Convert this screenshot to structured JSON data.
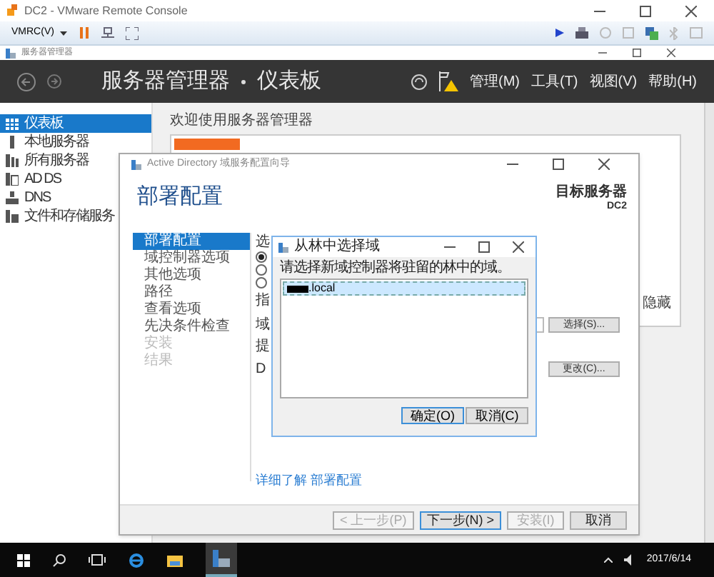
{
  "vmrc": {
    "title": "DC2 - VMware Remote Console",
    "menu": "VMRC(V)"
  },
  "server_manager": {
    "window_title": "服务器管理器",
    "breadcrumb": [
      "服务器管理器",
      "仪表板"
    ],
    "menus": [
      "管理(M)",
      "工具(T)",
      "视图(V)",
      "帮助(H)"
    ],
    "sidebar": [
      {
        "label": "仪表板",
        "selected": true,
        "kind": "dashboard"
      },
      {
        "label": "本地服务器",
        "selected": false,
        "kind": "server"
      },
      {
        "label": "所有服务器",
        "selected": false,
        "kind": "servers"
      },
      {
        "label": "AD DS",
        "selected": false,
        "kind": "adds"
      },
      {
        "label": "DNS",
        "selected": false,
        "kind": "dns"
      },
      {
        "label": "文件和存储服务",
        "selected": false,
        "kind": "files"
      }
    ],
    "welcome": "欢迎使用服务器管理器",
    "hide": "隐藏"
  },
  "wizard": {
    "title": "Active Directory 域服务配置向导",
    "heading": "部署配置",
    "target_label": "目标服务器",
    "target_value": "DC2",
    "steps": [
      {
        "label": "部署配置",
        "selected": true,
        "disabled": false
      },
      {
        "label": "域控制器选项",
        "selected": false,
        "disabled": false
      },
      {
        "label": "其他选项",
        "selected": false,
        "disabled": false
      },
      {
        "label": "路径",
        "selected": false,
        "disabled": false
      },
      {
        "label": "查看选项",
        "selected": false,
        "disabled": false
      },
      {
        "label": "先决条件检查",
        "selected": false,
        "disabled": false
      },
      {
        "label": "安装",
        "selected": false,
        "disabled": true
      },
      {
        "label": "结果",
        "selected": false,
        "disabled": true
      }
    ],
    "operation_label": "选",
    "radios": [
      {
        "selected": true
      },
      {
        "selected": false
      },
      {
        "selected": false
      }
    ],
    "spec_label": "指",
    "domain_label": "域",
    "select_button": "选择(S)...",
    "provide_label": "提",
    "credential_value": "D",
    "change_button": "更改(C)...",
    "link": "详细了解 部署配置",
    "footer_buttons": [
      {
        "label": "< 上一步(P)",
        "disabled": true,
        "focused": false
      },
      {
        "label": "下一步(N) >",
        "disabled": false,
        "focused": true
      },
      {
        "label": "安装(I)",
        "disabled": true,
        "focused": false
      },
      {
        "label": "取消",
        "disabled": false,
        "focused": false
      }
    ]
  },
  "dialog": {
    "title": "从林中选择域",
    "prompt": "请选择新域控制器将驻留的林中的域。",
    "items": [
      {
        "label": ".local",
        "selected": true,
        "redacted": true
      }
    ],
    "buttons": [
      {
        "label": "确定(O)",
        "focused": true
      },
      {
        "label": "取消(C)",
        "focused": false
      }
    ]
  },
  "taskbar": {
    "date": "2017/6/14"
  }
}
